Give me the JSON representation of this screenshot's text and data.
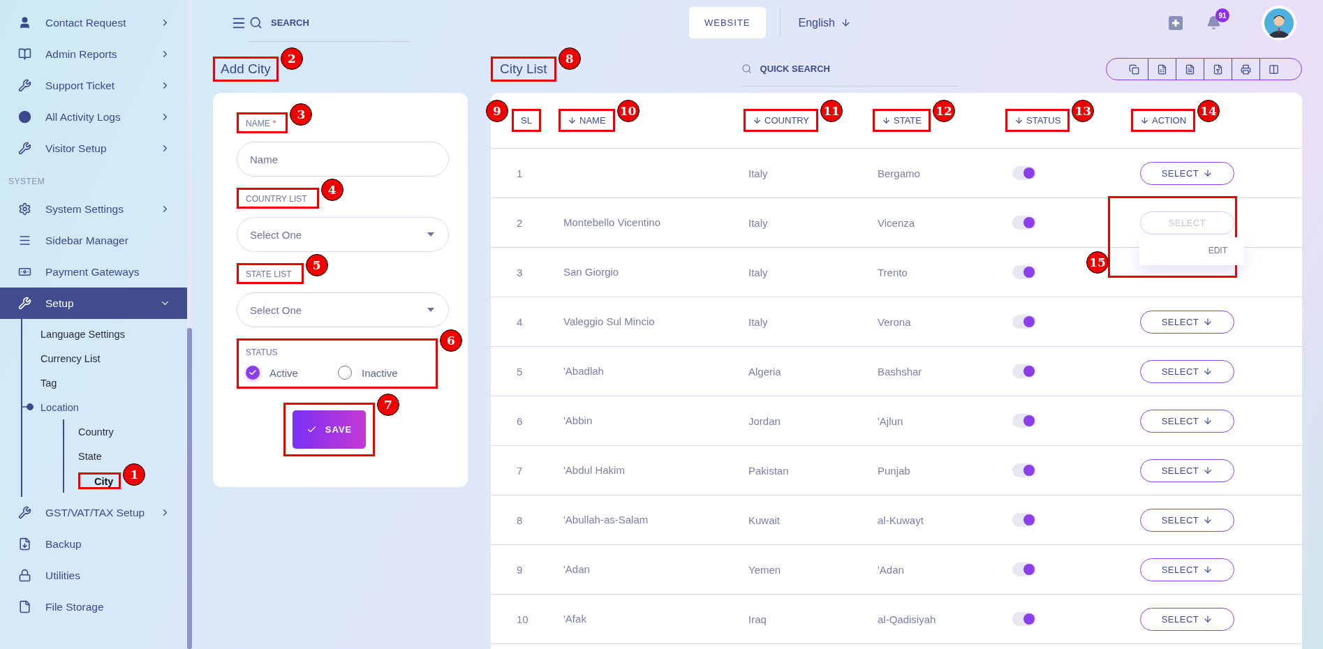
{
  "sidebar": {
    "sections": [
      {
        "items": [
          {
            "label": "Contact Request",
            "expanded": false,
            "selected": false
          },
          {
            "label": "Admin Reports",
            "expanded": false,
            "selected": false
          },
          {
            "label": "Support Ticket",
            "expanded": false,
            "selected": false
          },
          {
            "label": "All Activity Logs",
            "expanded": false,
            "selected": false
          },
          {
            "label": "Visitor Setup",
            "expanded": false,
            "selected": false
          }
        ]
      },
      {
        "heading": "SYSTEM",
        "items": [
          {
            "label": "System Settings",
            "expanded": false,
            "selected": false
          },
          {
            "label": "Sidebar Manager",
            "selected": false
          },
          {
            "label": "Payment Gateways",
            "selected": false
          },
          {
            "label": "Setup",
            "expanded": true,
            "selected": true,
            "children": [
              {
                "label": "Language Settings",
                "selected": false
              },
              {
                "label": "Currency List",
                "selected": false
              },
              {
                "label": "Tag",
                "selected": false
              },
              {
                "label": "Location",
                "expanded": true,
                "selected": false,
                "children": [
                  {
                    "label": "Country",
                    "selected": false
                  },
                  {
                    "label": "State",
                    "selected": false
                  },
                  {
                    "label": "City",
                    "selected": true,
                    "callout": "1"
                  }
                ]
              }
            ]
          },
          {
            "label": "GST/VAT/TAX Setup",
            "expanded": false,
            "selected": false
          },
          {
            "label": "Backup",
            "selected": false
          },
          {
            "label": "Utilities",
            "selected": false
          },
          {
            "label": "File Storage",
            "selected": false
          }
        ]
      }
    ]
  },
  "topbar": {
    "search": {
      "placeholder": "SEARCH"
    },
    "website_button": "WEBSITE",
    "language": "English",
    "notifications": "91"
  },
  "add_city": {
    "title": "Add City",
    "title_callout": "2",
    "fields": [
      {
        "kind": "text",
        "label": "NAME",
        "required_mark": "*",
        "placeholder": "Name",
        "callout": "3"
      },
      {
        "kind": "select",
        "label": "COUNTRY LIST",
        "value": "Select One",
        "callout": "4"
      },
      {
        "kind": "select",
        "label": "STATE LIST",
        "value": "Select One",
        "callout": "5"
      }
    ],
    "status": {
      "label": "STATUS",
      "callout": "6",
      "options": [
        {
          "label": "Active",
          "selected": true
        },
        {
          "label": "Inactive",
          "selected": false
        }
      ]
    },
    "save": {
      "label": "SAVE",
      "callout": "7"
    }
  },
  "city_list": {
    "title": "City List",
    "title_callout": "8",
    "quick_search": {
      "placeholder": "QUICK SEARCH"
    },
    "columns": [
      {
        "label": "SL",
        "sortable": false,
        "callout": "9"
      },
      {
        "label": "NAME",
        "sortable": true,
        "callout": "10"
      },
      {
        "label": "COUNTRY",
        "sortable": true,
        "callout": "11"
      },
      {
        "label": "STATE",
        "sortable": true,
        "callout": "12"
      },
      {
        "label": "STATUS",
        "sortable": true,
        "callout": "13"
      },
      {
        "label": "ACTION",
        "sortable": true,
        "callout": "14"
      }
    ],
    "rows": [
      {
        "sl": "1",
        "country": "Italy",
        "state": "Bergamo",
        "active": true,
        "action": {
          "label": "SELECT",
          "open": false
        }
      },
      {
        "sl": "2",
        "name": "Montebello Vicentino",
        "country": "Italy",
        "state": "Vicenza",
        "active": true,
        "action": {
          "label": "SELECT",
          "open": true,
          "menu": [
            "EDIT"
          ],
          "callout": "15"
        }
      },
      {
        "sl": "3",
        "name": "San Giorgio",
        "country": "Italy",
        "state": "Trento",
        "active": true
      },
      {
        "sl": "4",
        "name": "Valeggio Sul Mincio",
        "country": "Italy",
        "state": "Verona",
        "active": true,
        "action": {
          "label": "SELECT",
          "open": false
        }
      },
      {
        "sl": "5",
        "name": "'Abadlah",
        "country": "Algeria",
        "state": "Bashshar",
        "active": true,
        "action": {
          "label": "SELECT",
          "open": false
        }
      },
      {
        "sl": "6",
        "name": "'Abbin",
        "country": "Jordan",
        "state": "'Ajlun",
        "active": true,
        "action": {
          "label": "SELECT",
          "open": false
        }
      },
      {
        "sl": "7",
        "name": "'Abdul Hakim",
        "country": "Pakistan",
        "state": "Punjab",
        "active": true,
        "action": {
          "label": "SELECT",
          "open": false
        }
      },
      {
        "sl": "8",
        "name": "'Abullah-as-Salam",
        "country": "Kuwait",
        "state": "al-Kuwayt",
        "active": true,
        "action": {
          "label": "SELECT",
          "open": false
        }
      },
      {
        "sl": "9",
        "name": "'Adan",
        "country": "Yemen",
        "state": "'Adan",
        "active": true,
        "action": {
          "label": "SELECT",
          "open": false
        }
      },
      {
        "sl": "10",
        "name": "'Afak",
        "country": "Iraq",
        "state": "al-Qadisiyah",
        "active": true,
        "action": {
          "label": "SELECT",
          "open": false
        }
      }
    ]
  }
}
